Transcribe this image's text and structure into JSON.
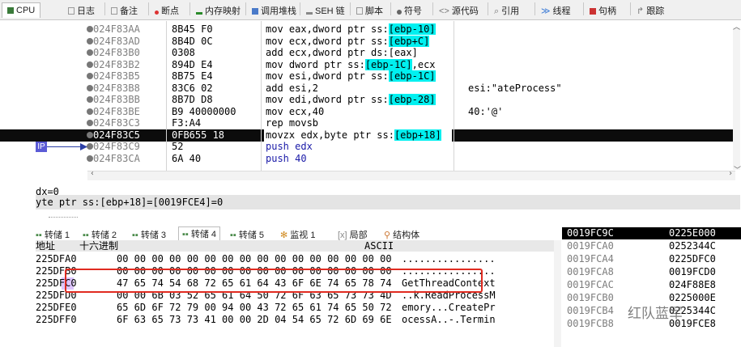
{
  "tabs": {
    "cpu": "CPU",
    "log": "日志",
    "notes": "备注",
    "breakpoints": "断点",
    "memory_map": "内存映射",
    "call_stack": "调用堆栈",
    "seh": "SEH 链",
    "script": "脚本",
    "symbols": "符号",
    "source": "源代码",
    "references": "引用",
    "threads": "线程",
    "handles": "句柄",
    "trace": "跟踪"
  },
  "disasm": {
    "rows": [
      {
        "addr": "024F83AA",
        "bytes": "8B45 F0",
        "pre": "mov eax,dword ptr ss:",
        "hl": "[ebp-10]",
        "post": "",
        "comment": ""
      },
      {
        "addr": "024F83AD",
        "bytes": "8B4D 0C",
        "pre": "mov ecx,dword ptr ss:",
        "hl": "[ebp+C]",
        "post": "",
        "comment": ""
      },
      {
        "addr": "024F83B0",
        "bytes": "0308",
        "pre": "add ecx,dword ptr ds:[eax]",
        "hl": "",
        "post": "",
        "comment": ""
      },
      {
        "addr": "024F83B2",
        "bytes": "894D E4",
        "pre": "mov dword ptr ss:",
        "hl": "[ebp-1C]",
        "post": ",ecx",
        "comment": ""
      },
      {
        "addr": "024F83B5",
        "bytes": "8B75 E4",
        "pre": "mov esi,dword ptr ss:",
        "hl": "[ebp-1C]",
        "post": "",
        "comment": ""
      },
      {
        "addr": "024F83B8",
        "bytes": "83C6 02",
        "pre": "add esi,2",
        "hl": "",
        "post": "",
        "comment": "esi:\"ateProcess\""
      },
      {
        "addr": "024F83BB",
        "bytes": "8B7D D8",
        "pre": "mov edi,dword ptr ss:",
        "hl": "[ebp-28]",
        "post": "",
        "comment": ""
      },
      {
        "addr": "024F83BE",
        "bytes": "B9 40000000",
        "pre": "mov ecx,40",
        "hl": "",
        "post": "",
        "comment": "40:'@'"
      },
      {
        "addr": "024F83C3",
        "bytes": "F3:A4",
        "pre": "rep movsb",
        "hl": "",
        "post": "",
        "comment": ""
      },
      {
        "addr": "024F83C5",
        "bytes": "0FB655 18",
        "pre": "movzx edx,byte ptr ss:",
        "hl": "[ebp+18]",
        "post": "",
        "comment": ""
      },
      {
        "addr": "024F83C9",
        "bytes": "52",
        "pre": "push edx",
        "hl": "",
        "post": "",
        "comment": ""
      },
      {
        "addr": "024F83CA",
        "bytes": "6A 40",
        "pre": "push 40",
        "hl": "",
        "post": "",
        "comment": ""
      }
    ],
    "ip_label": "IP"
  },
  "info": {
    "line1": "dx=0",
    "line2": "yte ptr ss:[ebp+18]=[0019FCE4]=0"
  },
  "dump_tabs": {
    "dump1": "转储 1",
    "dump2": "转储 2",
    "dump3": "转储 3",
    "dump4": "转储 4",
    "dump5": "转储 5",
    "watch": "监视 1",
    "locals": "局部",
    "struct": "结构体"
  },
  "dump": {
    "col_addr": "地址",
    "col_hex": "十六进制",
    "col_ascii": "ASCII",
    "rows": [
      {
        "addr": "225DFA0",
        "hex": "00 00 00 00 00 00 00 00 00 00 00 00 00 00 00 00",
        "ascii": "................"
      },
      {
        "addr": "225DFB0",
        "hex": "00 00 00 00 00 00 00 00 00 00 00 00 00 00 00 00",
        "ascii": "................"
      },
      {
        "addr": "225DFC0",
        "hex": "47 65 74 54 68 72 65 61 64 43 6F 6E 74 65 78 74",
        "ascii": "GetThreadContext"
      },
      {
        "addr": "225DFD0",
        "hex": "00 00 6B 03 52 65 61 64 50 72 6F 63 65 73 73 4D",
        "ascii": "..k.ReadProcessM"
      },
      {
        "addr": "225DFE0",
        "hex": "65 6D 6F 72 79 00 94 00 43 72 65 61 74 65 50 72",
        "ascii": "emory...CreatePr"
      },
      {
        "addr": "225DFF0",
        "hex": "6F 63 65 73 73 41 00 00 2D 04 54 65 72 6D 69 6E",
        "ascii": "ocessA..-.Termin"
      }
    ]
  },
  "stack": {
    "rows": [
      {
        "addr": "0019FC9C",
        "val": "0225E000"
      },
      {
        "addr": "0019FCA0",
        "val": "0252344C"
      },
      {
        "addr": "0019FCA4",
        "val": "0225DFC0"
      },
      {
        "addr": "0019FCA8",
        "val": "0019FCD0"
      },
      {
        "addr": "0019FCAC",
        "val": "024F88E8"
      },
      {
        "addr": "0019FCB0",
        "val": "0225000E"
      },
      {
        "addr": "0019FCB4",
        "val": "0225344C"
      },
      {
        "addr": "0019FCB8",
        "val": "0019FCE8"
      }
    ]
  },
  "watermark": "红队蓝军"
}
